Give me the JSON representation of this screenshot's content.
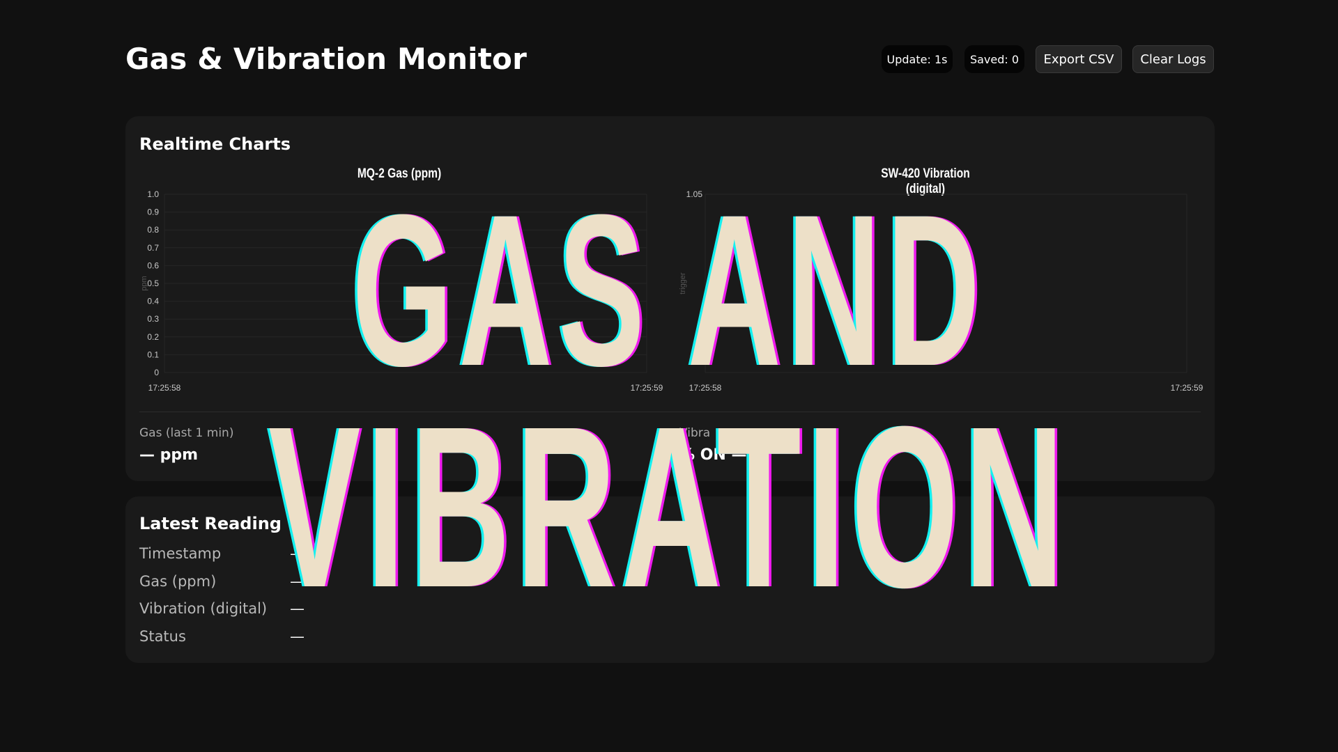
{
  "header": {
    "title": "Gas & Vibration Monitor",
    "update_badge": "Update: 1s",
    "saved_badge": "Saved: 0",
    "export_label": "Export CSV",
    "clear_label": "Clear Logs"
  },
  "charts_card": {
    "title": "Realtime Charts",
    "gas_stat_label": "Gas (last 1 min)",
    "gas_stat_value": "— ppm",
    "vib_stat_label": "Vibra",
    "vib_stat_value": "% ON —"
  },
  "latest": {
    "title": "Latest Reading",
    "rows": [
      {
        "label": "Timestamp",
        "value": "—"
      },
      {
        "label": "Gas (ppm)",
        "value": "—"
      },
      {
        "label": "Vibration (digital)",
        "value": "—"
      },
      {
        "label": "Status",
        "value": "—"
      }
    ]
  },
  "overlay": {
    "line1": "GAS AND",
    "line2": "VIBRATION",
    "colors": {
      "fill": "#ede0c8",
      "cyan": "#14f0f0",
      "magenta": "#ee1aee"
    }
  },
  "chart_data": [
    {
      "type": "line",
      "title": "MQ-2 Gas (ppm)",
      "ylabel": "ppm",
      "ylim": [
        0,
        1.0
      ],
      "y_ticks": [
        "0",
        "0.1",
        "0.2",
        "0.3",
        "0.4",
        "0.5",
        "0.6",
        "0.7",
        "0.8",
        "0.9",
        "1.0"
      ],
      "x_ticks": [
        "17:25:58",
        "17:25:59"
      ],
      "series": [],
      "grid": true
    },
    {
      "type": "line",
      "title": "SW-420 Vibration (digital)",
      "ylabel": "trigger",
      "y_ticks": [
        "1.05"
      ],
      "x_ticks": [
        "17:25:58",
        "17:25:59"
      ],
      "series": [],
      "grid": true
    }
  ]
}
